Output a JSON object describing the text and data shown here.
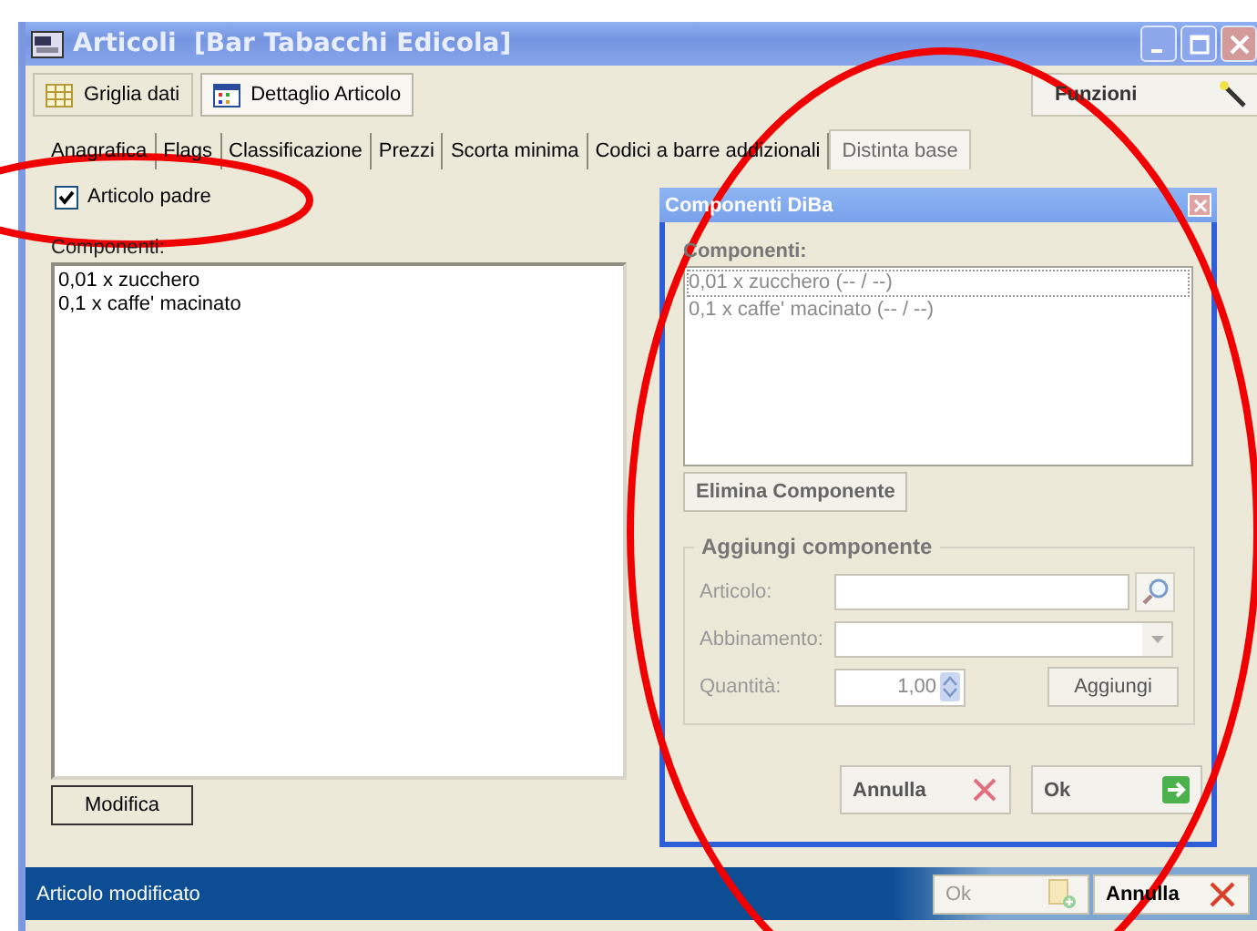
{
  "window": {
    "title": "Articoli  [Bar Tabacchi Edicola]"
  },
  "views": [
    {
      "label": "Griglia dati",
      "kind": "grid",
      "selected": false
    },
    {
      "label": "Dettaglio Articolo",
      "kind": "detail",
      "selected": true
    }
  ],
  "functions_button": {
    "label": "Funzioni"
  },
  "tabs": [
    {
      "label": "Anagrafica",
      "selected": false
    },
    {
      "label": "Flags",
      "selected": false
    },
    {
      "label": "Classificazione",
      "selected": false
    },
    {
      "label": "Prezzi",
      "selected": false
    },
    {
      "label": "Scorta minima",
      "selected": false
    },
    {
      "label": "Codici a barre addizionali",
      "selected": false
    },
    {
      "label": "Distinta base",
      "selected": true
    }
  ],
  "parent_checkbox": {
    "label": "Articolo padre",
    "checked": true
  },
  "components_label": "Componenti:",
  "components": [
    "0,01 x zucchero",
    "0,1 x caffe' macinato"
  ],
  "modify_button": "Modifica",
  "dialog": {
    "title": "Componenti DiBa",
    "list_label": "Componenti:",
    "items": [
      {
        "text": "0,01 x zucchero (-- / --)",
        "selected": true
      },
      {
        "text": "0,1 x caffe' macinato (-- / --)",
        "selected": false
      }
    ],
    "remove_button": "Elimina Componente",
    "group_title": "Aggiungi componente",
    "article_label": "Articolo:",
    "pairing_label": "Abbinamento:",
    "quantity_label": "Quantità:",
    "quantity_value": "1,00",
    "add_button": "Aggiungi",
    "cancel_button": "Annulla",
    "ok_button": "Ok"
  },
  "status_bar": {
    "message": "Articolo modificato",
    "buttons": [
      {
        "label": "Ok",
        "kind": "ok",
        "disabled": true
      },
      {
        "label": "Annulla",
        "kind": "cancel",
        "disabled": false
      }
    ]
  },
  "annotations": [
    {
      "kind": "ellipse"
    },
    {
      "kind": "ellipse"
    }
  ]
}
